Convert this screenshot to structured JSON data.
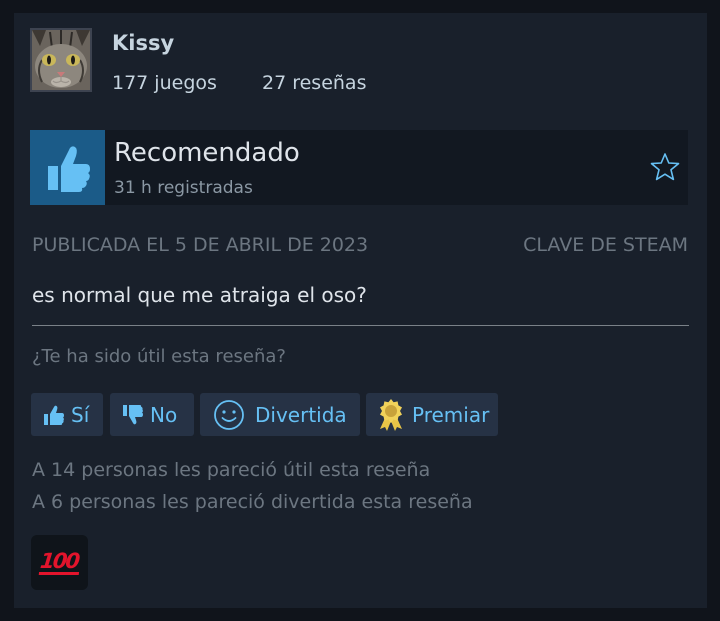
{
  "author": {
    "name": "Kissy",
    "games": "177 juegos",
    "reviews": "27 reseñas",
    "avatar": "cat-face-avatar"
  },
  "review": {
    "verdict": "Recomendado",
    "hours": "31 h registradas",
    "posted": "PUBLICADA EL 5 DE ABRIL DE 2023",
    "source": "CLAVE DE STEAM",
    "text": "es normal que me atraiga el oso?"
  },
  "feedback": {
    "question": "¿Te ha sido útil esta reseña?",
    "yes_label": "Sí",
    "no_label": "No",
    "funny_label": "Divertida",
    "award_label": "Premiar",
    "helpful_count": "A 14 personas les pareció útil esta reseña",
    "funny_count": "A 6 personas les pareció divertida esta reseña"
  },
  "reaction": {
    "badge": "100",
    "icon": "hundred-points-icon"
  },
  "colors": {
    "background": "#10141b",
    "card": "#19202b",
    "accent": "#66c0f4",
    "thumb_box": "#1b5b88",
    "button": "#263245",
    "muted_text": "#6c7681",
    "badge_red": "#e3142c"
  }
}
